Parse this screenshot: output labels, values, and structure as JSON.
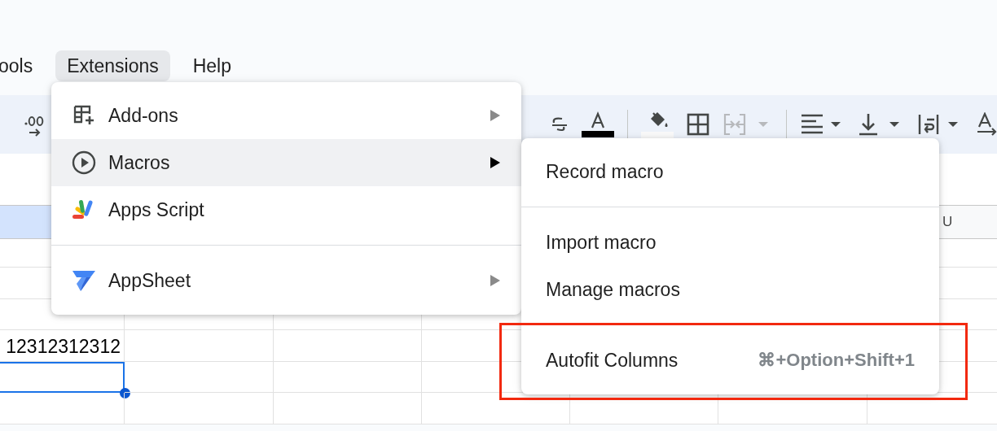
{
  "menu_bar": [
    {
      "label": "ools",
      "selected": false
    },
    {
      "label": "Extensions",
      "selected": true
    },
    {
      "label": "Help",
      "selected": false
    }
  ],
  "sheet": {
    "first_column_header": {
      "selected": true
    },
    "last_column_header": {
      "label": "U"
    },
    "rows": [
      {
        "selected": false
      },
      {
        "selected": false
      },
      {
        "selected": false
      },
      {
        "value": "12312312312",
        "selected": false
      },
      {
        "selected": true
      },
      {
        "selected": false
      }
    ]
  },
  "extensions_menu": {
    "items": [
      {
        "kind": "item",
        "label": "Add-ons",
        "has_submenu": true,
        "highlighted": false
      },
      {
        "kind": "item",
        "label": "Macros",
        "has_submenu": true,
        "highlighted": true
      },
      {
        "kind": "item",
        "label": "Apps Script",
        "has_submenu": false,
        "highlighted": false
      },
      {
        "kind": "divider"
      },
      {
        "kind": "item",
        "label": "AppSheet",
        "has_submenu": true,
        "highlighted": false
      }
    ]
  },
  "macros_submenu": {
    "items": [
      {
        "kind": "item",
        "label": "Record macro"
      },
      {
        "kind": "divider"
      },
      {
        "kind": "item",
        "label": "Import macro"
      },
      {
        "kind": "item",
        "label": "Manage macros"
      },
      {
        "kind": "divider"
      },
      {
        "kind": "item",
        "label": "Autofit Columns",
        "shortcut": "⌘+Option+Shift+1"
      }
    ]
  }
}
